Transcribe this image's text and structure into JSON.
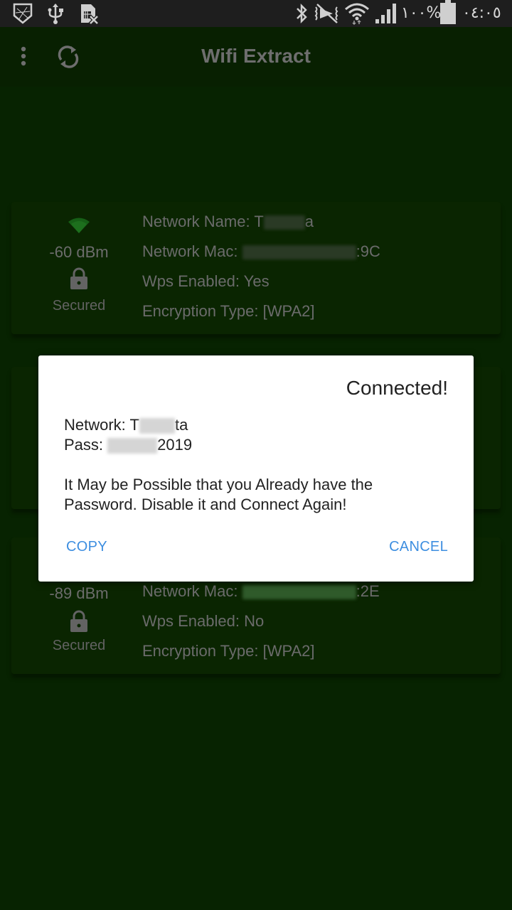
{
  "status_bar": {
    "left_icons": [
      "shield-app-icon",
      "usb-icon",
      "no-sim-icon"
    ],
    "right_icons": [
      "bluetooth-icon",
      "vibrate-off-icon",
      "wifi-data-icon",
      "cell-signal-icon"
    ],
    "battery_percent": "١٠٠%",
    "battery_level": 1.0,
    "time": "٠٤:٠٥"
  },
  "app_bar": {
    "title": "Wifi Extract",
    "menu_icon": "more-vertical-icon",
    "refresh_icon": "refresh-icon"
  },
  "networks": [
    {
      "signal": "-60 dBm",
      "security": "Secured",
      "name_label": "Network Name: ",
      "name_prefix": "T",
      "name_suffix": "a",
      "mac_label": "Network Mac: ",
      "mac_suffix": ":9C",
      "wps": "Wps Enabled: Yes",
      "encryption": "Encryption Type: [WPA2]"
    },
    {
      "signal": "-89 dBm",
      "security": "Secured",
      "mac_label": "Network Mac: ",
      "mac_suffix": ":2E",
      "wps": "Wps Enabled: No",
      "encryption": "Encryption Type: [WPA2]"
    }
  ],
  "dialog": {
    "title": "Connected!",
    "network_label": "Network: ",
    "network_prefix": "T",
    "network_suffix": "ta",
    "pass_label": "Pass: ",
    "pass_suffix": "2019",
    "message_line1": "It May be Possible that you Already have the",
    "message_line2": "Password. Disable it and Connect Again!",
    "copy_label": "COPY",
    "cancel_label": "CANCEL",
    "accent_color": "#3d8ee0"
  }
}
